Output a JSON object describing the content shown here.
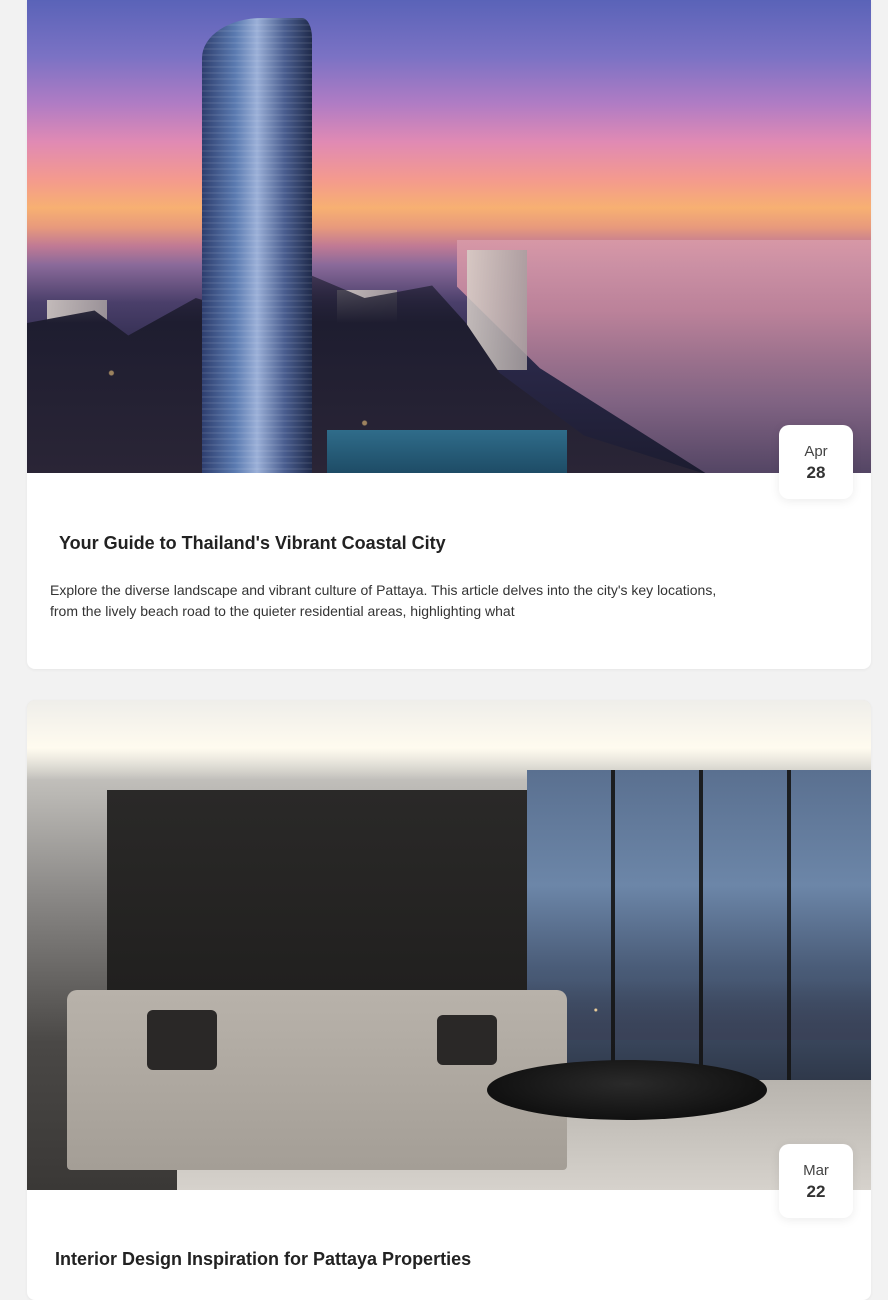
{
  "posts": [
    {
      "image_alt": "Pattaya skyline at sunset",
      "date_month": "Apr",
      "date_day": "28",
      "title": "Your Guide to Thailand's Vibrant Coastal City",
      "excerpt": "Explore the diverse landscape and vibrant culture of Pattaya. This article delves into the city's key locations, from the lively beach road to the quieter residential areas, highlighting what"
    },
    {
      "image_alt": "Modern living room with city view",
      "date_month": "Mar",
      "date_day": "22",
      "title": "Interior Design Inspiration for Pattaya Properties",
      "excerpt": ""
    }
  ]
}
